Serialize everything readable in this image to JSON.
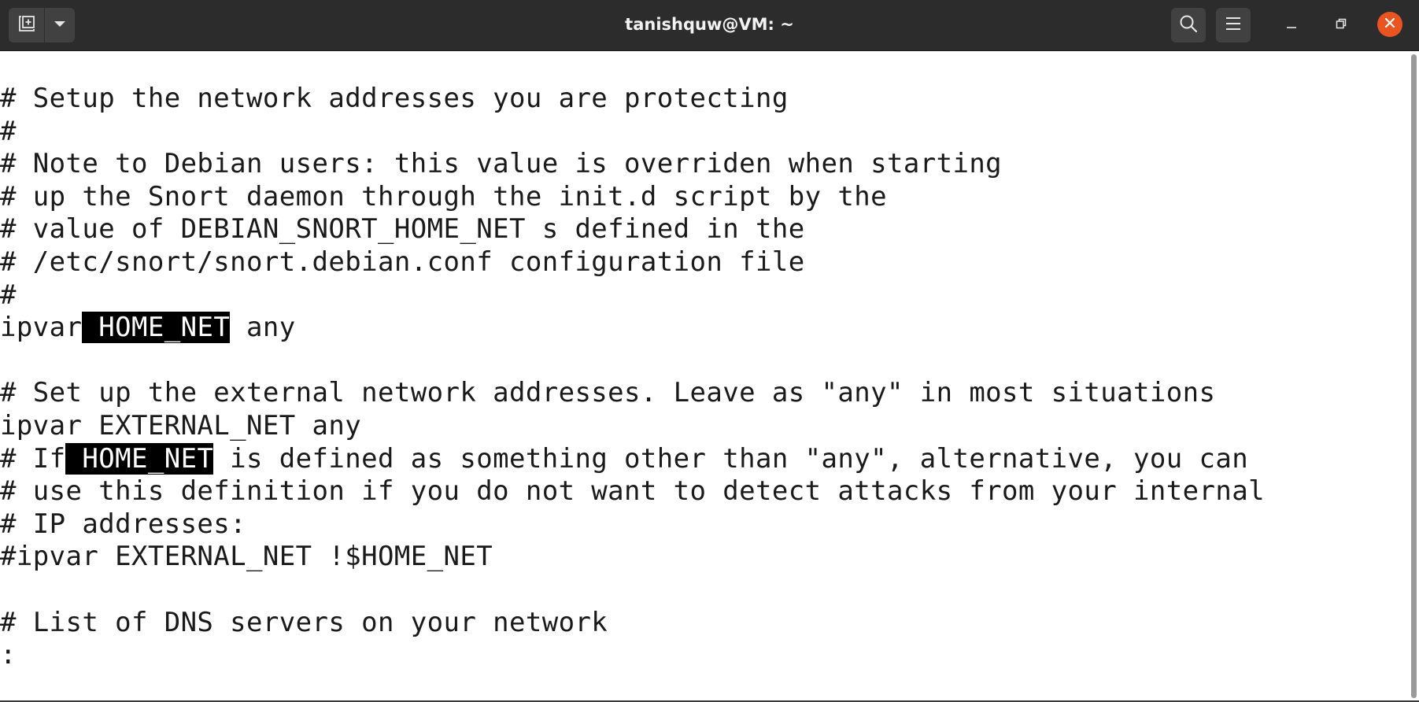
{
  "window": {
    "title": "tanishquw@VM: ~"
  },
  "titlebar": {
    "icons": {
      "new_tab": "new-tab-icon",
      "dropdown": "chevron-down-icon",
      "search": "search-icon",
      "menu": "hamburger-menu-icon",
      "minimize": "minimize-icon",
      "restore": "restore-icon",
      "close": "close-icon"
    },
    "close_color": "#e95420"
  },
  "terminal": {
    "lines": [
      "# Setup the network addresses you are protecting",
      "#",
      "# Note to Debian users: this value is overriden when starting",
      "# up the Snort daemon through the init.d script by the",
      "# value of DEBIAN_SNORT_HOME_NET s defined in the",
      "# /etc/snort/snort.debian.conf configuration file",
      "#",
      "ipvar",
      " HOME_NET",
      " any",
      "",
      "# Set up the external network addresses. Leave as \"any\" in most situations",
      "ipvar EXTERNAL_NET any",
      "# If",
      " HOME_NET",
      " is defined as something other than \"any\", alternative, you can",
      "# use this definition if you do not want to detect attacks from your internal",
      "# IP addresses:",
      "#ipvar EXTERNAL_NET !$HOME_NET",
      "",
      "# List of DNS servers on your network",
      ":"
    ]
  }
}
